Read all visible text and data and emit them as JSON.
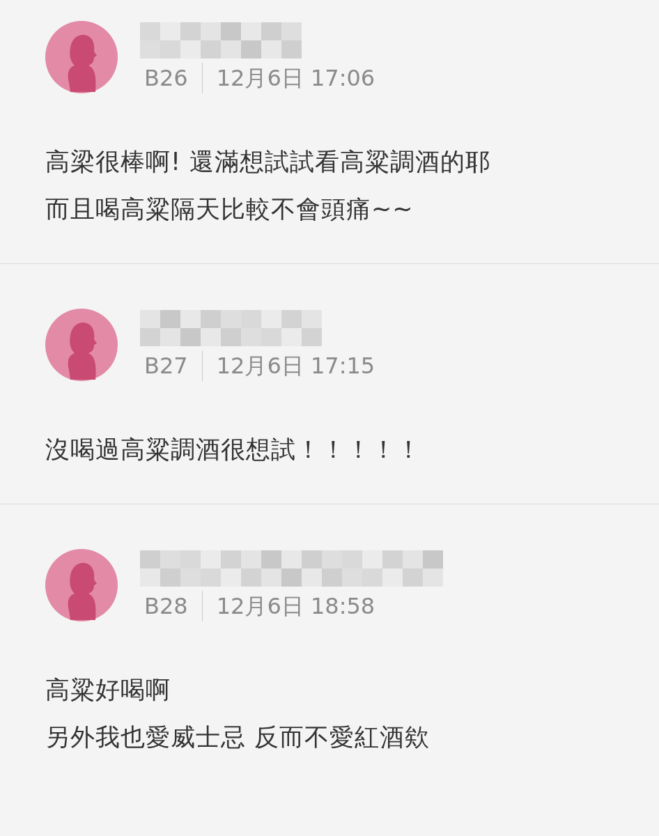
{
  "comments": [
    {
      "floor": "B26",
      "time": "12月6日 17:06",
      "lines": [
        "高梁很棒啊! 還滿想試試看高粱調酒的耶",
        "而且喝高粱隔天比較不會頭痛~~"
      ]
    },
    {
      "floor": "B27",
      "time": "12月6日 17:15",
      "lines": [
        "沒喝過高粱調酒很想試！！！！！"
      ]
    },
    {
      "floor": "B28",
      "time": "12月6日 18:58",
      "lines": [
        "高粱好喝啊",
        "另外我也愛威士忌 反而不愛紅酒欸"
      ]
    }
  ]
}
